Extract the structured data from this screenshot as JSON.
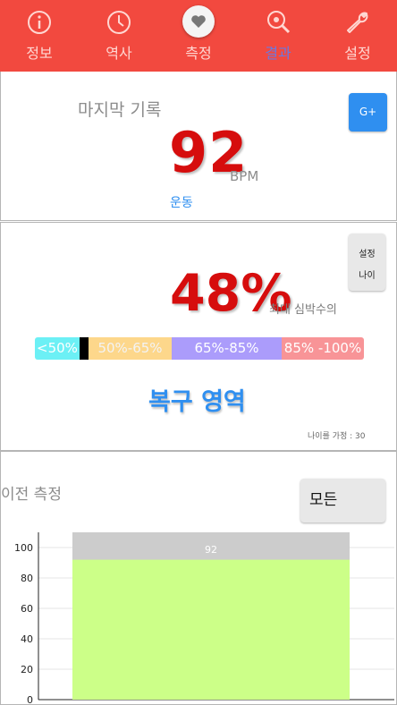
{
  "nav": {
    "items": [
      {
        "label": "정보",
        "icon": "info-icon",
        "active": false
      },
      {
        "label": "역사",
        "icon": "clock-icon",
        "active": false
      },
      {
        "label": "측정",
        "icon": "heart-icon",
        "active": false
      },
      {
        "label": "결과",
        "icon": "magnifier-icon",
        "active": true
      },
      {
        "label": "설정",
        "icon": "wrench-icon",
        "active": false
      }
    ]
  },
  "last_record": {
    "title": "마지막 기록",
    "share_button": "G+",
    "bpm": "92",
    "unit": "BPM",
    "activity": "운동"
  },
  "zone": {
    "set_age_button": {
      "line1": "설정",
      "line2": "나이"
    },
    "percent": "48%",
    "caption": "최대 심박수의",
    "segments": [
      {
        "label": "<50%",
        "color": "#6cf0f5"
      },
      {
        "label": "50%-65%",
        "color": "#fdd78b"
      },
      {
        "label": "65%-85%",
        "color": "#ab9cfb"
      },
      {
        "label": "85% -100%",
        "color": "#f89497"
      }
    ],
    "marker_percent": 48,
    "zone_name": "복구 영역",
    "age_note": "나이를 가정 : 30"
  },
  "previous": {
    "title": "이전 측정",
    "filter_button": "모든"
  },
  "chart_data": {
    "type": "bar",
    "categories": [
      ""
    ],
    "series": [
      {
        "values": [
          92
        ],
        "color": "#ccff88"
      }
    ],
    "max_bar": {
      "values": [
        110
      ],
      "color": "#cccccc"
    },
    "data_labels": [
      "92"
    ],
    "ylim": [
      0,
      110
    ],
    "yticks": [
      0,
      20,
      40,
      60,
      80,
      100
    ],
    "grid": true,
    "accent": "#d60d0d"
  }
}
